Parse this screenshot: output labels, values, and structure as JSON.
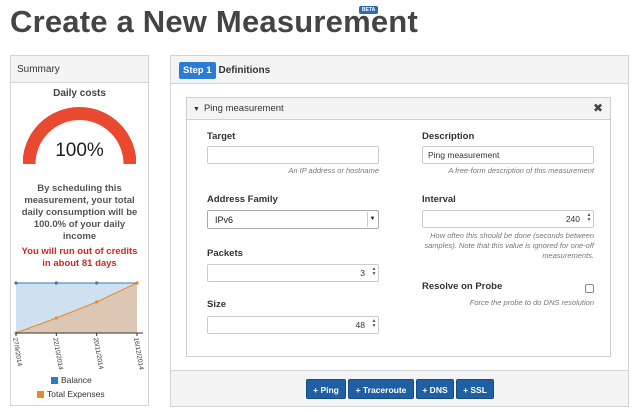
{
  "page": {
    "title": "Create a New Measurement",
    "beta_badge": "BETA"
  },
  "summary": {
    "header": "Summary",
    "daily_costs_label": "Daily costs",
    "gauge_value": "100%",
    "gauge_fraction": 1.0,
    "consumption_text": "By scheduling this measurement, your total daily consumption will be 100.0% of your daily income",
    "credits_warning": "You will run out of credits in about 81 days",
    "colors": {
      "gauge": "#e8492f",
      "balance": "#2f7bc3",
      "expenses": "#e8892f"
    }
  },
  "chart_data": {
    "type": "area",
    "x": [
      "27/9/2014",
      "22/10/2014",
      "20/11/2014",
      "16/12/2014"
    ],
    "series": [
      {
        "name": "Balance",
        "values": [
          100,
          100,
          100,
          100
        ]
      },
      {
        "name": "Total Expenses",
        "values": [
          0,
          30,
          62,
          100
        ]
      }
    ],
    "ylim": [
      0,
      100
    ],
    "legend": "bottom"
  },
  "wizard": {
    "step_badge": "Step 1",
    "step_title": "Definitions"
  },
  "definition": {
    "title": "Ping measurement",
    "close_icon": "close-icon",
    "target": {
      "label": "Target",
      "value": "",
      "help": "An IP address or hostname"
    },
    "description": {
      "label": "Description",
      "value": "Ping measurement",
      "help": "A free-form description of this measurement"
    },
    "address_family": {
      "label": "Address Family",
      "selected": "IPv6"
    },
    "interval": {
      "label": "Interval",
      "value": "240",
      "help": "How often this should be done (seconds between samples). Note that this value is ignored for one-off measurements."
    },
    "packets": {
      "label": "Packets",
      "value": "3"
    },
    "resolve_on_probe": {
      "label": "Resolve on Probe",
      "help": "Force the probe to do DNS resolution",
      "checked": false
    },
    "size": {
      "label": "Size",
      "value": "48"
    }
  },
  "add_buttons": [
    "+ Ping",
    "+ Traceroute",
    "+ DNS",
    "+ SSL"
  ]
}
